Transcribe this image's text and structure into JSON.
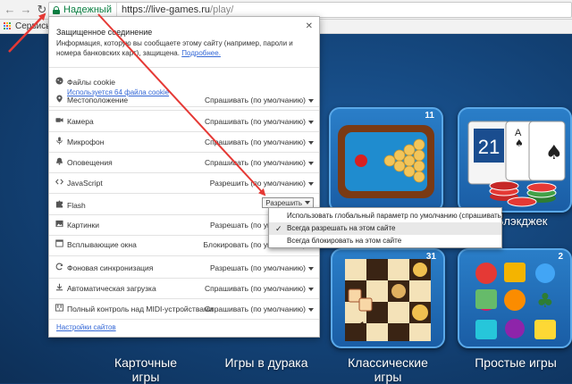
{
  "browser": {
    "secure_label": "Надежный",
    "url_host": "https://live-games.ru",
    "url_path": "/play/",
    "bookmark_label": "Сервисы"
  },
  "popup": {
    "title": "Защищенное соединение",
    "description": "Информация, которую вы сообщаете этому сайту (например, пароли и номера банковских карт), защищена.",
    "details_link": "Подробнее.",
    "cookies": {
      "label": "Файлы cookie",
      "sub_link": "Используется 64 файла cookie"
    },
    "permissions": [
      {
        "icon": "location-pin-icon",
        "label": "Местоположение",
        "value": "Спрашивать (по умолчанию)"
      },
      {
        "icon": "camera-icon",
        "label": "Камера",
        "value": "Спрашивать (по умолчанию)"
      },
      {
        "icon": "microphone-icon",
        "label": "Микрофон",
        "value": "Спрашивать (по умолчанию)"
      },
      {
        "icon": "bell-icon",
        "label": "Оповещения",
        "value": "Спрашивать (по умолчанию)"
      },
      {
        "icon": "code-icon",
        "label": "JavaScript",
        "value": "Разрешить (по умолчанию)"
      },
      {
        "icon": "puzzle-icon",
        "label": "Flash",
        "value": "Разрешить"
      },
      {
        "icon": "image-icon",
        "label": "Картинки",
        "value": "Разрешать (по умолчанию)"
      },
      {
        "icon": "popup-window-icon",
        "label": "Всплывающие окна",
        "value": "Блокировать (по умолчанию)"
      },
      {
        "icon": "sync-icon",
        "label": "Фоновая синхронизация",
        "value": "Разрешать (по умолчанию)"
      },
      {
        "icon": "download-icon",
        "label": "Автоматическая загрузка",
        "value": "Спрашивать (по умолчанию)"
      },
      {
        "icon": "piano-icon",
        "label": "Полный контроль над MIDI-устройствами",
        "value": "Спрашивать (по умолчанию)"
      }
    ],
    "site_settings_link": "Настройки сайтов"
  },
  "dropdown": {
    "options": [
      "Использовать глобальный параметр по умолчанию (спрашивать)",
      "Всегда разрешать на этом сайте",
      "Всегда блокировать на этом сайте"
    ],
    "selected_index": 1
  },
  "page": {
    "tiles": [
      {
        "count": "11"
      },
      {
        "caption": "Блэкджек"
      },
      {
        "count": "31"
      },
      {
        "count": "2"
      }
    ],
    "blackjack_card": "21",
    "captions": {
      "cards_line1": "Карточные",
      "cards_line2": "игры",
      "durak": "Игры в дурака",
      "classic_line1": "Классические",
      "classic_line2": "игры",
      "simple": "Простые игры"
    }
  },
  "colors": {
    "secure_green": "#0b8043",
    "link_blue": "#3367d6",
    "annotation_red": "#e53935"
  }
}
